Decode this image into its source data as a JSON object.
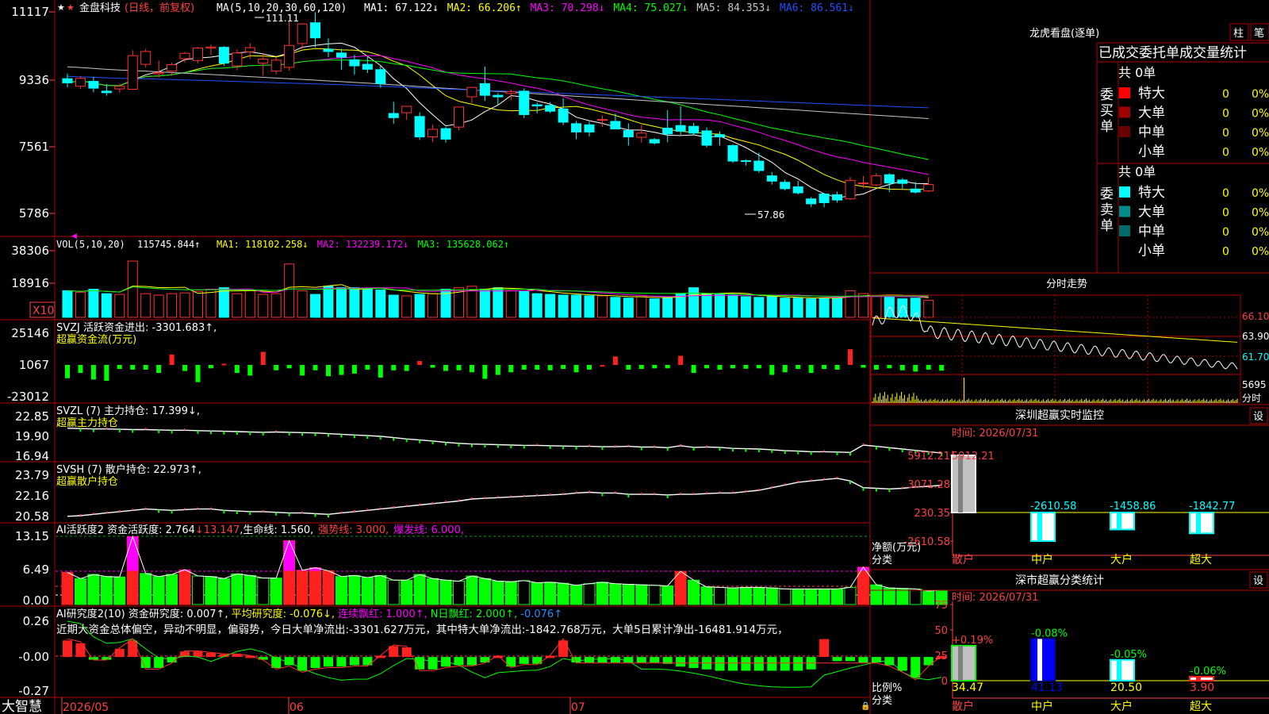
{
  "main": {
    "stock_name": "金盘科技",
    "period_label": "(日线，前复权)",
    "ma_header": "MA(5,10,20,30,60,120)",
    "ma_values": [
      {
        "label": "MA1: 67.122↓",
        "color": "#ffffff"
      },
      {
        "label": "MA2: 66.206↑",
        "color": "#ffff00"
      },
      {
        "label": "MA3: 70.298↓",
        "color": "#ff00ff"
      },
      {
        "label": "MA4: 75.027↓",
        "color": "#00ff00"
      },
      {
        "label": "MA5: 84.353↓",
        "color": "#c8c8c8"
      },
      {
        "label": "MA6: 86.561↓",
        "color": "#1e50ff"
      }
    ],
    "y_ticks": [
      "11117",
      "9336",
      "7561",
      "5786"
    ],
    "high_label": "111.11",
    "low_label": "57.86"
  },
  "vol": {
    "header": "VOL(5,10,20)",
    "value": "115745.844↑",
    "ma": [
      {
        "label": "MA1: 118102.258↓",
        "color": "#ffff00"
      },
      {
        "label": "MA2: 132239.172↓",
        "color": "#ff00ff"
      },
      {
        "label": "MA3: 135628.062↑",
        "color": "#00ff00"
      }
    ],
    "y_ticks": [
      "38306",
      "18916"
    ],
    "unit": "X10"
  },
  "svzj": {
    "header": "SVZJ  活跃资金进出: -3301.683↑,",
    "subtitle": "超赢资金流(万元)",
    "y_ticks": [
      "25146",
      "1067",
      "-23012"
    ]
  },
  "svzl": {
    "header": "SVZL (7) 主力持仓: 17.399↓,",
    "subtitle": "超赢主力持仓",
    "y_ticks": [
      "22.85",
      "19.90",
      "16.94"
    ]
  },
  "svsh": {
    "header": "SVSH (7) 散户持仓: 22.973↑,",
    "subtitle": "超赢散户持仓",
    "y_ticks": [
      "23.79",
      "22.16",
      "20.58"
    ]
  },
  "ai2": {
    "header": "AI活跃度2 资金活跃度: 2.764",
    "v2": "↓13.147",
    "v3": ",生命线: 1.560,",
    "v4": "强势线: 3.000,",
    "v5": "爆发线: 6.000,",
    "y_ticks": [
      "13.15",
      "6.49",
      "0.00"
    ]
  },
  "ai3": {
    "h1": "AI研究度2(10) 资金研究度: 0.007↑,",
    "h2": "平均研究度: -0.076↓,",
    "h3": "连续飘红: 1.000↑,",
    "h4": "N日飘红: 2.000↑,",
    "h5": "-0.076↑",
    "summary": "近期大资金总体偏空，异动不明显，偏弱势，今日大单净流出:-3301.627万元，其中特大单净流出:-1842.768万元，大单5日累计净出-16481.914万元，",
    "y_ticks": [
      "0.26",
      "-0.00",
      "-0.27"
    ]
  },
  "footer": {
    "brand": "大智慧",
    "dates": [
      "2026/05",
      "06",
      "07"
    ]
  },
  "right": {
    "title": "龙虎看盘(逐单)",
    "btn1": "柱",
    "btn2": "笔",
    "subtitle": "已成交委托单成交量统计",
    "buy_label": "委买单",
    "sell_label": "委卖单",
    "buy_total": "共 0单",
    "sell_total": "共 0单",
    "buy_rows": [
      {
        "name": "特大",
        "count": "0",
        "pct": "0%",
        "color": "#ff0000"
      },
      {
        "name": "大单",
        "count": "0",
        "pct": "0%",
        "color": "#a00000"
      },
      {
        "name": "中单",
        "count": "0",
        "pct": "0%",
        "color": "#6a0000"
      },
      {
        "name": "小单",
        "count": "0",
        "pct": "0%",
        "color": ""
      }
    ],
    "sell_rows": [
      {
        "name": "特大",
        "count": "0",
        "pct": "0%",
        "color": "#00ffff"
      },
      {
        "name": "大单",
        "count": "0",
        "pct": "0%",
        "color": "#008c8c"
      },
      {
        "name": "中单",
        "count": "0",
        "pct": "0%",
        "color": "#006a6a"
      },
      {
        "name": "小单",
        "count": "0",
        "pct": "0%",
        "color": ""
      }
    ],
    "intraday_title": "分时走势",
    "intraday_ticks": [
      "66.10",
      "63.90",
      "61.70",
      "5695"
    ],
    "intraday_unit": "分时",
    "sz_title": "深圳超赢实时监控",
    "sz_time": "时间: 2026/07/31",
    "sz_btn": "设",
    "sz_y_ticks": [
      "5912.21",
      "3071.28",
      "230.35",
      "-2610.58"
    ],
    "sz_y_title1": "净额(万元)",
    "sz_y_title2": "分类",
    "sz_cats": [
      "散户",
      "中户",
      "大户",
      "超大"
    ],
    "sz_vals": [
      "5912.21",
      "-2610.58",
      "-1458.86",
      "-1842.77"
    ],
    "cls_title": "深市超赢分类统计",
    "cls_time": "时间: 2026/07/31",
    "cls_btn": "设",
    "cls_y_ticks": [
      "75",
      "50",
      "25",
      "0"
    ],
    "cls_y_title1": "比例%",
    "cls_y_title2": "分类",
    "cls_cats": [
      "散户",
      "中户",
      "大户",
      "超大"
    ],
    "cls_top": [
      "+0.19%",
      "-0.08%",
      "-0.05%",
      "-0.06%"
    ],
    "cls_bottom": [
      "34.47",
      "41.13",
      "20.50",
      "3.90"
    ]
  },
  "chart_data": [
    {
      "type": "candlestick",
      "title": "金盘科技 (日线，前复权)",
      "ylim": [
        57.86,
        111.11
      ],
      "y_ticks": [
        111.17,
        93.36,
        75.61,
        57.86
      ],
      "high_marker": 111.11,
      "low_marker": 57.86,
      "ohlc": [
        [
          93.5,
          94.8,
          91.2,
          92.4
        ],
        [
          91.5,
          94.2,
          90.8,
          93.6
        ],
        [
          92.8,
          94,
          89.9,
          91
        ],
        [
          90.2,
          92.1,
          89,
          89.8
        ],
        [
          90.8,
          92.2,
          89.8,
          91.5
        ],
        [
          90.7,
          101,
          90.5,
          99.6
        ],
        [
          97.3,
          101.4,
          96.5,
          100.7
        ],
        [
          94.8,
          98.3,
          93.8,
          95.1
        ],
        [
          95.5,
          97.8,
          94.3,
          97.2
        ],
        [
          98.8,
          100.6,
          97.7,
          100.2
        ],
        [
          98.3,
          101.9,
          97.6,
          101.6
        ],
        [
          101.6,
          102.5,
          99.8,
          101.9
        ],
        [
          101.8,
          102.1,
          96.9,
          97.6
        ],
        [
          96.9,
          101.2,
          95.7,
          100.3
        ],
        [
          100.6,
          102.9,
          98.8,
          101.7
        ],
        [
          97.6,
          100,
          94.3,
          98.7
        ],
        [
          95.5,
          99.2,
          94.7,
          98.4
        ],
        [
          96.5,
          108.8,
          95.6,
          102.3
        ],
        [
          102.8,
          108.2,
          101.4,
          108
        ],
        [
          108.3,
          111.11,
          101.8,
          104.3
        ],
        [
          101.3,
          104.2,
          99.2,
          100.7
        ],
        [
          100.3,
          101.4,
          95.9,
          99.2
        ],
        [
          98.5,
          99.8,
          94.6,
          96.9
        ],
        [
          97.3,
          99.2,
          95,
          96
        ],
        [
          95.9,
          97.1,
          91.1,
          92.2
        ],
        [
          84.3,
          87.4,
          81.6,
          83.2
        ],
        [
          84.5,
          86.3,
          82.6,
          86.2
        ],
        [
          83.5,
          84.6,
          77.3,
          78.1
        ],
        [
          78.1,
          81.4,
          76.7,
          80.1
        ],
        [
          80.3,
          80.7,
          76.6,
          77.5
        ],
        [
          80.7,
          86.1,
          79.8,
          86
        ],
        [
          88.7,
          91.4,
          87,
          91.2
        ],
        [
          92.2,
          96.7,
          87.6,
          89.1
        ],
        [
          89.1,
          89.7,
          86.6,
          88.7
        ],
        [
          89.6,
          90.6,
          87.8,
          90.1
        ],
        [
          90.2,
          90.9,
          83.1,
          84
        ],
        [
          86.6,
          87.2,
          84.3,
          86.3
        ],
        [
          86.4,
          87.3,
          84.4,
          84.9
        ],
        [
          85.5,
          88.3,
          81.2,
          82
        ],
        [
          81.6,
          82.3,
          77.5,
          79.4
        ],
        [
          81.3,
          82.1,
          78.2,
          79.4
        ],
        [
          82.6,
          83.8,
          80.7,
          82.7
        ],
        [
          82.2,
          84.3,
          80.1,
          80.2
        ],
        [
          79.8,
          81.7,
          75.8,
          78.1
        ],
        [
          78,
          81.3,
          76.6,
          79.1
        ],
        [
          77.4,
          77.8,
          76.1,
          76.5
        ],
        [
          80.4,
          85.2,
          76.7,
          78.9
        ],
        [
          81.1,
          86.2,
          78.7,
          79.6
        ],
        [
          80.9,
          81.8,
          78.5,
          79.1
        ],
        [
          79.7,
          80.6,
          75.3,
          75.9
        ],
        [
          78.7,
          79.6,
          75.8,
          78.1
        ],
        [
          75.8,
          76.2,
          71.2,
          71.7
        ],
        [
          71.8,
          72.2,
          70.5,
          71.6
        ],
        [
          71.7,
          73.9,
          68.6,
          69.2
        ],
        [
          67.8,
          68.8,
          65.5,
          66.4
        ],
        [
          66.1,
          66.8,
          63.9,
          64.4
        ],
        [
          64.9,
          66.5,
          62.9,
          63.3
        ],
        [
          61.7,
          62.2,
          59.6,
          60.4
        ],
        [
          63,
          63.3,
          59.5,
          60.7
        ],
        [
          62.8,
          63.6,
          60.7,
          61.4
        ],
        [
          61.7,
          67.5,
          61.4,
          66.6
        ],
        [
          65.8,
          67.8,
          64.5,
          65.9
        ],
        [
          65.4,
          68.5,
          65.1,
          67.8
        ],
        [
          68.1,
          68.5,
          63.5,
          65.9
        ],
        [
          66.7,
          67.2,
          64.4,
          65.8
        ],
        [
          64.3,
          66.2,
          63.1,
          63.5
        ],
        [
          63.8,
          67.4,
          63.5,
          65.5
        ]
      ]
    },
    {
      "type": "bar",
      "title": "VOL(5,10,20)",
      "ylim": [
        0,
        45000
      ],
      "values": [
        18000,
        17000,
        19000,
        16000,
        15500,
        38000,
        16000,
        15000,
        16000,
        16500,
        17500,
        19000,
        20000,
        16000,
        18000,
        15500,
        16000,
        36000,
        18000,
        15500,
        21000,
        20000,
        20000,
        19500,
        18500,
        15000,
        14500,
        15500,
        16000,
        19000,
        20000,
        21000,
        19000,
        20000,
        18000,
        17500,
        16000,
        15500,
        15000,
        15000,
        14500,
        14500,
        13500,
        13000,
        14000,
        12500,
        13500,
        16000,
        20000,
        16000,
        15500,
        15000,
        14000,
        13500,
        14000,
        13000,
        13000,
        12500,
        13000,
        13000,
        18000,
        16000,
        15000,
        14000,
        12500,
        13000,
        11574
      ]
    },
    {
      "type": "bar",
      "title": "SVZJ 活跃资金进出",
      "ylim": [
        -23012,
        25146
      ],
      "values": [
        -9000,
        -5000,
        -10000,
        -11000,
        -2000,
        -2500,
        -2500,
        -5000,
        9000,
        -3500,
        -12000,
        -1500,
        2000,
        -5000,
        -7000,
        11000,
        -3000,
        -1500,
        -7000,
        -3000,
        -7500,
        -6500,
        -5500,
        -2500,
        -8500,
        -3000,
        -3500,
        4000,
        -1000,
        -3500,
        -3000,
        -4500,
        -9500,
        -6500,
        -4500,
        -2500,
        -2500,
        -3000,
        -2000,
        -4500,
        -2500,
        1000,
        7500,
        -2500,
        -2000,
        -1500,
        -1500,
        8000,
        -5000,
        -1500,
        -2500,
        -1500,
        -1800,
        -1500,
        -6500,
        -4500,
        -2000,
        -5000,
        -2000,
        -2500,
        13000,
        -1000,
        -2500,
        -1500,
        -3000,
        -4000,
        -2500,
        -3301.683
      ]
    },
    {
      "type": "line",
      "title": "SVZL (7) 主力持仓",
      "ylim": [
        16.94,
        22.85
      ],
      "values": [
        21.1,
        21.05,
        21.0,
        21.0,
        20.95,
        20.9,
        20.9,
        20.85,
        20.8,
        20.8,
        20.75,
        20.7,
        20.65,
        20.6,
        20.55,
        20.5,
        20.55,
        20.5,
        20.45,
        20.4,
        20.3,
        20.2,
        20.1,
        20.0,
        19.9,
        19.7,
        19.5,
        19.35,
        19.2,
        19.0,
        18.85,
        18.75,
        18.7,
        18.65,
        18.6,
        18.55,
        18.55,
        18.5,
        18.45,
        18.4,
        18.4,
        18.35,
        18.35,
        18.4,
        18.3,
        18.3,
        18.2,
        18.5,
        18.25,
        18.3,
        18.25,
        18.1,
        18.05,
        18.0,
        17.9,
        17.75,
        17.7,
        17.6,
        17.6,
        17.55,
        17.5,
        18.6,
        18.4,
        18.2,
        18.0,
        17.8,
        17.6,
        17.399
      ]
    },
    {
      "type": "line",
      "title": "SVSH (7) 散户持仓",
      "ylim": [
        20.58,
        23.79
      ],
      "values": [
        20.65,
        20.7,
        20.8,
        20.9,
        21.0,
        21.1,
        21.2,
        21.15,
        21.1,
        21.15,
        21.2,
        21.2,
        21.1,
        21.05,
        21.0,
        21.0,
        20.95,
        20.9,
        20.9,
        20.85,
        20.8,
        20.9,
        21.0,
        21.1,
        21.2,
        21.3,
        21.4,
        21.5,
        21.6,
        21.7,
        21.8,
        21.95,
        22.0,
        22.05,
        22.1,
        22.15,
        22.2,
        22.25,
        22.3,
        22.4,
        22.45,
        22.4,
        22.4,
        22.3,
        22.3,
        22.3,
        22.25,
        22.3,
        22.3,
        22.35,
        22.4,
        22.4,
        22.5,
        22.6,
        22.8,
        23.0,
        23.2,
        23.3,
        23.4,
        23.5,
        23.3,
        22.8,
        22.75,
        22.7,
        22.75,
        22.85,
        22.9,
        22.973
      ]
    },
    {
      "type": "bar",
      "title": "AI活跃度2",
      "ylim": [
        0,
        13.15
      ],
      "values": [
        6.2,
        5,
        5.8,
        5.4,
        5.3,
        13.1,
        6,
        5.4,
        5.8,
        6.7,
        5.5,
        5.4,
        5,
        5.9,
        5.6,
        5.1,
        5.1,
        12.3,
        6.6,
        7.1,
        6.5,
        5.4,
        5.6,
        5.2,
        5.6,
        4.7,
        4.7,
        5.8,
        5,
        4.7,
        4.5,
        5.5,
        5,
        4.5,
        4.4,
        4.6,
        4.2,
        4.3,
        4.1,
        3.7,
        4,
        4.3,
        4,
        3.9,
        3.8,
        3.7,
        3.6,
        6.4,
        4.7,
        3.4,
        3.3,
        3.2,
        3.3,
        3.3,
        3.2,
        3,
        3,
        3,
        3,
        3,
        3.3,
        7.2,
        3.8,
        3.2,
        3.1,
        3,
        2.6,
        2.764
      ]
    },
    {
      "type": "bar",
      "title": "AI研究度2(10)",
      "ylim": [
        -0.27,
        0.26
      ],
      "values": [
        0.12,
        0.1,
        -0.02,
        -0.02,
        0.06,
        0.12,
        -0.08,
        -0.08,
        -0.04,
        0.04,
        0.04,
        0.03,
        0.02,
        0.02,
        0.01,
        -0.02,
        -0.08,
        -0.06,
        -0.1,
        -0.08,
        -0.07,
        -0.07,
        -0.06,
        -0.06,
        0.01,
        0.08,
        0.07,
        -0.09,
        -0.09,
        -0.07,
        -0.06,
        -0.06,
        -0.04,
        0.01,
        -0.07,
        -0.05,
        -0.05,
        0.01,
        0.12,
        -0.04,
        -0.04,
        -0.04,
        -0.04,
        -0.04,
        -0.04,
        -0.04,
        -0.05,
        -0.07,
        -0.08,
        -0.09,
        -0.1,
        -0.1,
        -0.1,
        -0.1,
        -0.1,
        -0.1,
        -0.1,
        -0.09,
        0.13,
        -0.03,
        -0.03,
        -0.04,
        -0.04,
        -0.06,
        -0.1,
        -0.15,
        -0.06,
        0.007
      ]
    },
    {
      "type": "bar",
      "title": "深圳超赢实时监控",
      "categories": [
        "散户",
        "中户",
        "大户",
        "超大"
      ],
      "values": [
        5912.21,
        -2610.58,
        -1458.86,
        -1842.77
      ],
      "ylabel": "净额(万元)",
      "ylim": [
        -2610.58,
        5912.21
      ]
    },
    {
      "type": "bar",
      "title": "深市超赢分类统计",
      "categories": [
        "散户",
        "中户",
        "大户",
        "超大"
      ],
      "values": [
        34.47,
        41.13,
        20.5,
        3.9
      ],
      "changes": [
        "+0.19%",
        "-0.08%",
        "-0.05%",
        "-0.06%"
      ],
      "ylabel": "比例%",
      "ylim": [
        0,
        75
      ]
    }
  ]
}
